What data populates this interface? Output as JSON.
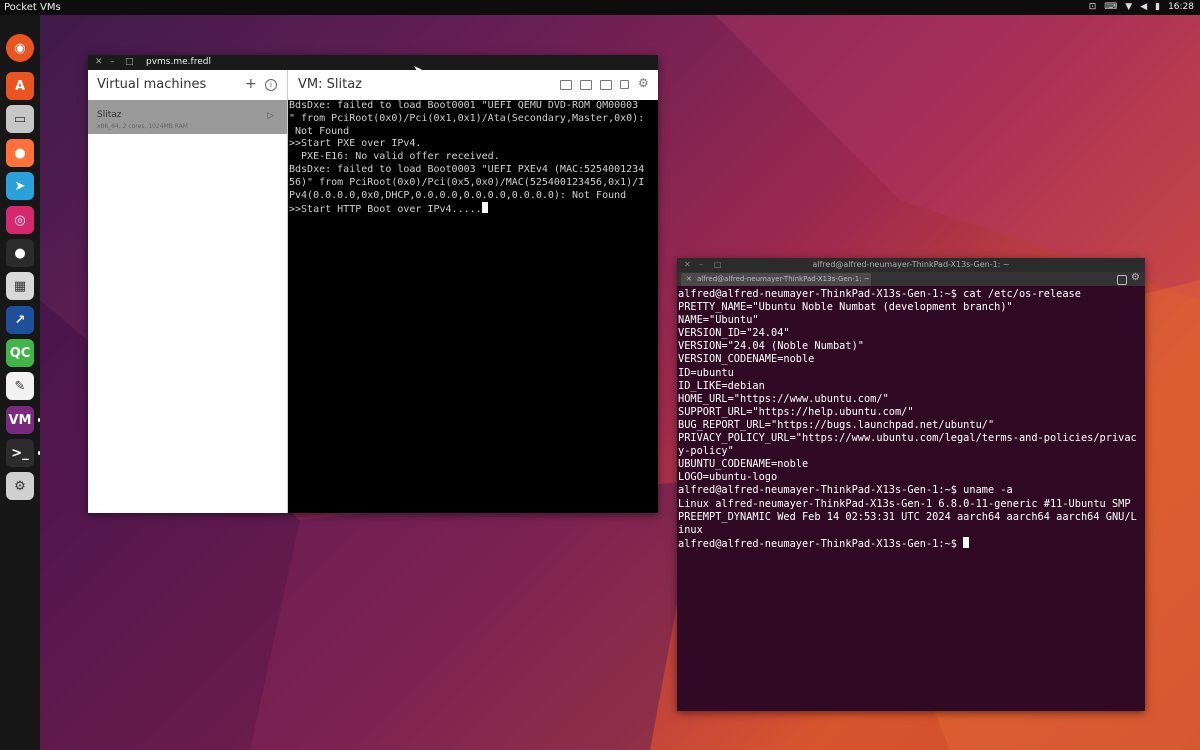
{
  "topbar": {
    "app_name": "Pocket VMs",
    "time": "16:28",
    "tray_icons": [
      "screen-record-icon",
      "keyboard-icon",
      "wifi-icon",
      "volume-icon",
      "battery-icon"
    ]
  },
  "dock": {
    "items": [
      {
        "name": "ubuntu-logo-icon",
        "glyph": "◉",
        "color": "#e95420"
      },
      {
        "name": "app-center-icon",
        "glyph": "A",
        "color": "#e95420"
      },
      {
        "name": "file-manager-icon",
        "glyph": "▭",
        "color": "#c7c7c7"
      },
      {
        "name": "firefox-icon",
        "glyph": "●",
        "color": "#ff7139"
      },
      {
        "name": "telegram-icon",
        "glyph": "➤",
        "color": "#2aa1da"
      },
      {
        "name": "instagram-icon",
        "glyph": "◎",
        "color": "#d6286e"
      },
      {
        "name": "traffic-light-icon",
        "glyph": "●",
        "color": "#2b2b2b"
      },
      {
        "name": "calculator-icon",
        "glyph": "▦",
        "color": "#d8d8d8"
      },
      {
        "name": "remote-desktop-icon",
        "glyph": "↗",
        "color": "#1d4f9a"
      },
      {
        "name": "qc-icon",
        "glyph": "QC",
        "color": "#41b54a"
      },
      {
        "name": "text-editor-icon",
        "glyph": "✎",
        "color": "#f2f2f2"
      },
      {
        "name": "vm-icon",
        "glyph": "VM",
        "color": "#7a2a7e"
      },
      {
        "name": "terminal-icon",
        "glyph": ">_",
        "color": "#2c2c2c"
      },
      {
        "name": "settings-icon",
        "glyph": "⚙",
        "color": "#d0d0d0"
      }
    ]
  },
  "vm_window": {
    "title": "pvms.me.fredl",
    "sidebar_title": "Virtual machines",
    "add_label": "+",
    "info_label": "i",
    "vm": {
      "name": "Slitaz",
      "desc": "x86_64, 2 cores, 1024MB RAM",
      "play": "▷"
    },
    "main_title": "VM: Slitaz",
    "console_lines": [
      "BdsDxe: failed to load Boot0001 \"UEFI QEMU DVD-ROM QM00003",
      "\" from PciRoot(0x0)/Pci(0x1,0x1)/Ata(Secondary,Master,0x0):",
      " Not Found",
      "",
      ">>Start PXE over IPv4.",
      "  PXE-E16: No valid offer received.",
      "BdsDxe: failed to load Boot0003 \"UEFI PXEv4 (MAC:5254001234",
      "56)\" from PciRoot(0x0)/Pci(0x5,0x0)/MAC(525400123456,0x1)/I",
      "Pv4(0.0.0.0,0x0,DHCP,0.0.0.0,0.0.0.0,0.0.0.0): Not Found",
      "",
      ">>Start HTTP Boot over IPv4....."
    ]
  },
  "terminal": {
    "title": "alfred@alfred-neumayer-ThinkPad-X13s-Gen-1: ~",
    "tab_label": "alfred@alfred-neumayer-ThinkPad-X13s-Gen-1: ~",
    "lines": [
      "alfred@alfred-neumayer-ThinkPad-X13s-Gen-1:~$ cat /etc/os-release",
      "PRETTY_NAME=\"Ubuntu Noble Numbat (development branch)\"",
      "NAME=\"Ubuntu\"",
      "VERSION_ID=\"24.04\"",
      "VERSION=\"24.04 (Noble Numbat)\"",
      "VERSION_CODENAME=noble",
      "ID=ubuntu",
      "ID_LIKE=debian",
      "HOME_URL=\"https://www.ubuntu.com/\"",
      "SUPPORT_URL=\"https://help.ubuntu.com/\"",
      "BUG_REPORT_URL=\"https://bugs.launchpad.net/ubuntu/\"",
      "PRIVACY_POLICY_URL=\"https://www.ubuntu.com/legal/terms-and-policies/privac",
      "y-policy\"",
      "UBUNTU_CODENAME=noble",
      "LOGO=ubuntu-logo",
      "alfred@alfred-neumayer-ThinkPad-X13s-Gen-1:~$ uname -a",
      "Linux alfred-neumayer-ThinkPad-X13s-Gen-1 6.8.0-11-generic #11-Ubuntu SMP",
      "PREEMPT_DYNAMIC Wed Feb 14 02:53:31 UTC 2024 aarch64 aarch64 aarch64 GNU/L",
      "inux",
      "alfred@alfred-neumayer-ThinkPad-X13s-Gen-1:~$ "
    ]
  }
}
